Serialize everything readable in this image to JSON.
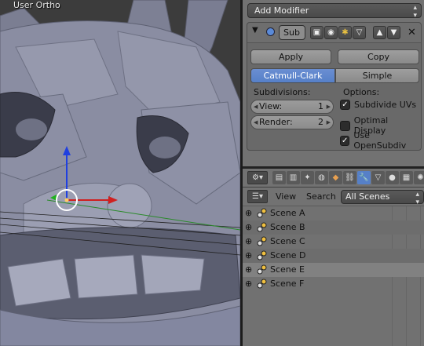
{
  "viewport": {
    "label": "User Ortho"
  },
  "properties": {
    "add_modifier": "Add Modifier",
    "modifier": {
      "name_short": "Sub",
      "apply_label": "Apply",
      "copy_label": "Copy",
      "tabs": [
        "Catmull-Clark",
        "Simple"
      ],
      "active_tab": "Catmull-Clark",
      "subdivisions_label": "Subdivisions:",
      "view_label": "View:",
      "view_value": "1",
      "render_label": "Render:",
      "render_value": "2",
      "options_label": "Options:",
      "options": [
        {
          "label": "Subdivide UVs",
          "checked": true
        },
        {
          "label": "Optimal Display",
          "checked": false
        },
        {
          "label": "Use OpenSubdiv",
          "checked": true
        }
      ]
    }
  },
  "outliner": {
    "view_label": "View",
    "search_label": "Search",
    "filter_value": "All Scenes",
    "rows": [
      {
        "name": "Scene A"
      },
      {
        "name": "Scene B"
      },
      {
        "name": "Scene C"
      },
      {
        "name": "Scene D"
      },
      {
        "name": "Scene E"
      },
      {
        "name": "Scene F"
      }
    ]
  },
  "colors": {
    "accent": "#5680c8",
    "mesh": "#8c8fa4",
    "axis_x": "#d02020",
    "axis_y": "#20b020",
    "axis_z": "#2040e0"
  }
}
